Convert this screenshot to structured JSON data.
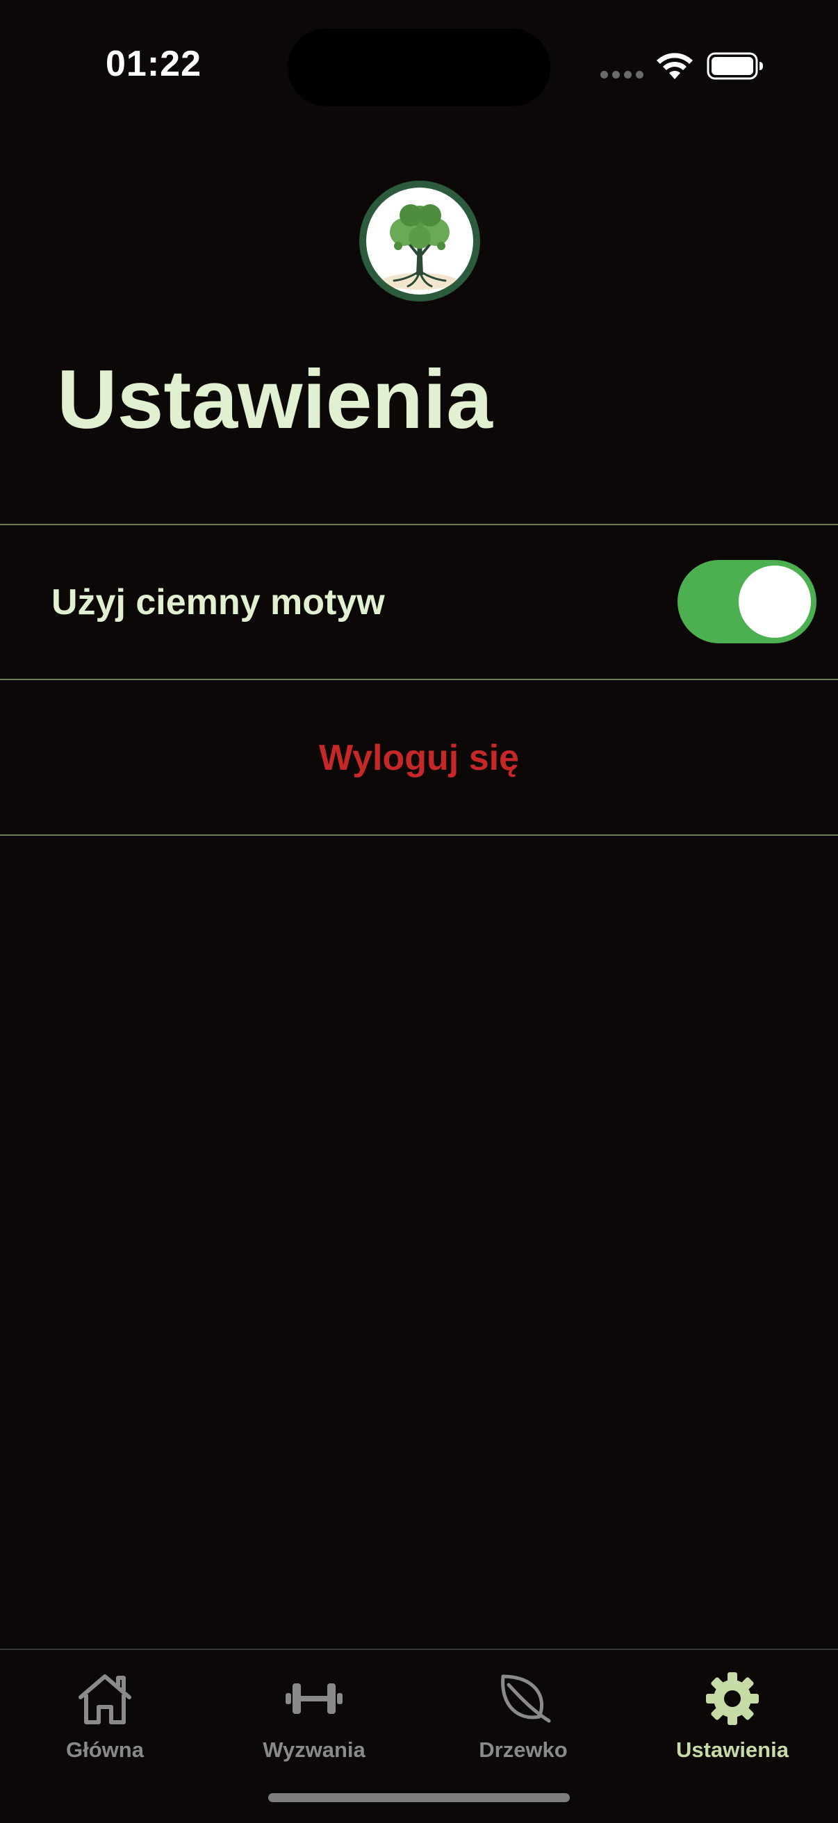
{
  "status_bar": {
    "time": "01:22"
  },
  "header": {
    "logo_icon": "tree-logo-icon",
    "title": "Ustawienia"
  },
  "settings": {
    "dark_theme_label": "Użyj ciemny motyw",
    "dark_theme_enabled": true,
    "logout_label": "Wyloguj się"
  },
  "tab_bar": {
    "tabs": [
      {
        "label": "Główna",
        "icon": "home-icon",
        "active": false
      },
      {
        "label": "Wyzwania",
        "icon": "dumbbell-icon",
        "active": false
      },
      {
        "label": "Drzewko",
        "icon": "leaf-icon",
        "active": false
      },
      {
        "label": "Ustawienia",
        "icon": "gear-icon",
        "active": true
      }
    ]
  },
  "colors": {
    "background": "#0c0808",
    "title_text": "#e2f0d2",
    "divider": "#6e7a52",
    "toggle_on": "#4caf50",
    "logout_text": "#c62828",
    "tab_active": "#c7dba6",
    "tab_inactive": "#8a8a8a"
  }
}
